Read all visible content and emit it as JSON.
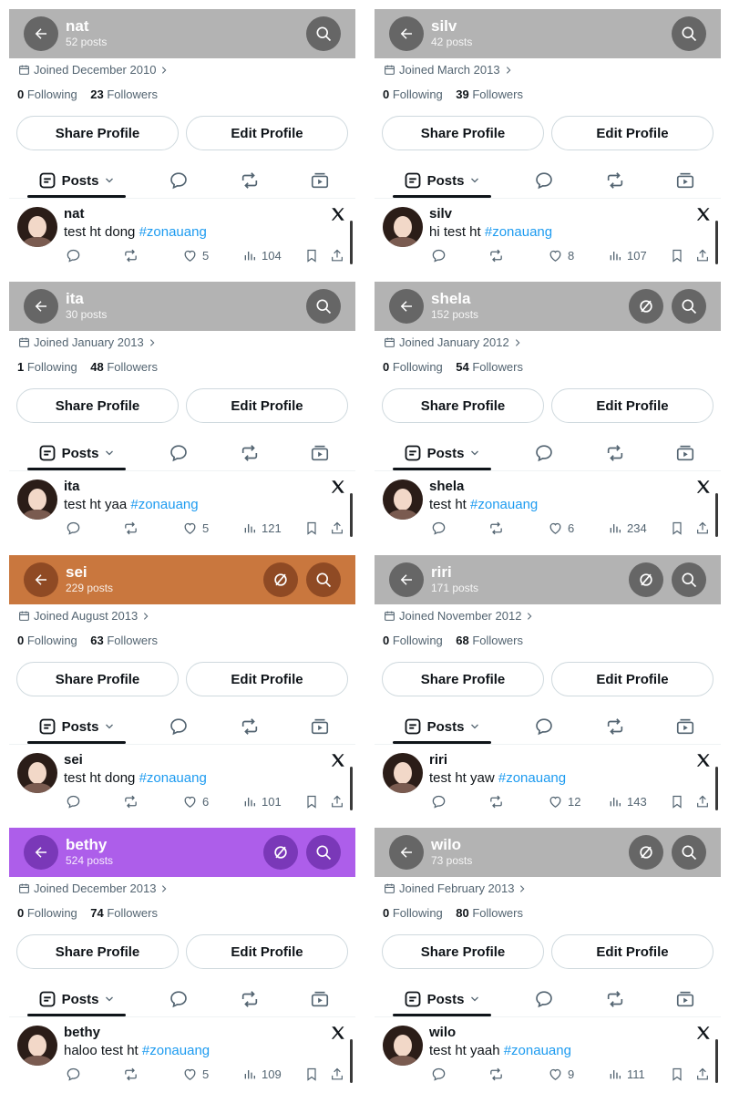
{
  "colors": {
    "gray_header": "#b3b3b3",
    "gray_button": "#666666",
    "orange_header": "#c9773e",
    "orange_button": "#8f4a24",
    "purple_header": "#ad5eea",
    "purple_button": "#7a38b8",
    "link_blue": "#1d9bf0"
  },
  "labels": {
    "following": "Following",
    "followers": "Followers",
    "share": "Share Profile",
    "edit": "Edit Profile",
    "posts_tab": "Posts"
  },
  "profiles": [
    {
      "name": "nat",
      "posts": "52 posts",
      "joined": "Joined December 2010",
      "following": "0",
      "followers": "23",
      "tweet_text": "test ht dong ",
      "hashtag": "#zonauang",
      "likes": "5",
      "views": "104",
      "theme": "gray",
      "extra_icon": false
    },
    {
      "name": "silv",
      "posts": "42 posts",
      "joined": "Joined March 2013",
      "following": "0",
      "followers": "39",
      "tweet_text": "hi test ht ",
      "hashtag": "#zonauang",
      "likes": "8",
      "views": "107",
      "theme": "gray",
      "extra_icon": false
    },
    {
      "name": "ita",
      "posts": "30 posts",
      "joined": "Joined January 2013",
      "following": "1",
      "followers": "48",
      "tweet_text": "test ht yaa ",
      "hashtag": "#zonauang",
      "likes": "5",
      "views": "121",
      "theme": "gray",
      "extra_icon": false
    },
    {
      "name": "shela",
      "posts": "152 posts",
      "joined": "Joined January 2012",
      "following": "0",
      "followers": "54",
      "tweet_text": "test ht ",
      "hashtag": "#zonauang",
      "likes": "6",
      "views": "234",
      "theme": "gray",
      "extra_icon": true
    },
    {
      "name": "sei",
      "posts": "229 posts",
      "joined": "Joined August 2013",
      "following": "0",
      "followers": "63",
      "tweet_text": "test ht dong ",
      "hashtag": "#zonauang",
      "likes": "6",
      "views": "101",
      "theme": "orange",
      "extra_icon": true
    },
    {
      "name": "riri",
      "posts": "171 posts",
      "joined": "Joined November 2012",
      "following": "0",
      "followers": "68",
      "tweet_text": "test ht yaw ",
      "hashtag": "#zonauang",
      "likes": "12",
      "views": "143",
      "theme": "gray",
      "extra_icon": true
    },
    {
      "name": "bethy",
      "posts": "524 posts",
      "joined": "Joined December 2013",
      "following": "0",
      "followers": "74",
      "tweet_text": "haloo test ht ",
      "hashtag": "#zonauang",
      "likes": "5",
      "views": "109",
      "theme": "purple",
      "extra_icon": true
    },
    {
      "name": "wilo",
      "posts": "73 posts",
      "joined": "Joined February 2013",
      "following": "0",
      "followers": "80",
      "tweet_text": "test ht yaah ",
      "hashtag": "#zonauang",
      "likes": "9",
      "views": "111",
      "theme": "gray",
      "extra_icon": true
    }
  ]
}
